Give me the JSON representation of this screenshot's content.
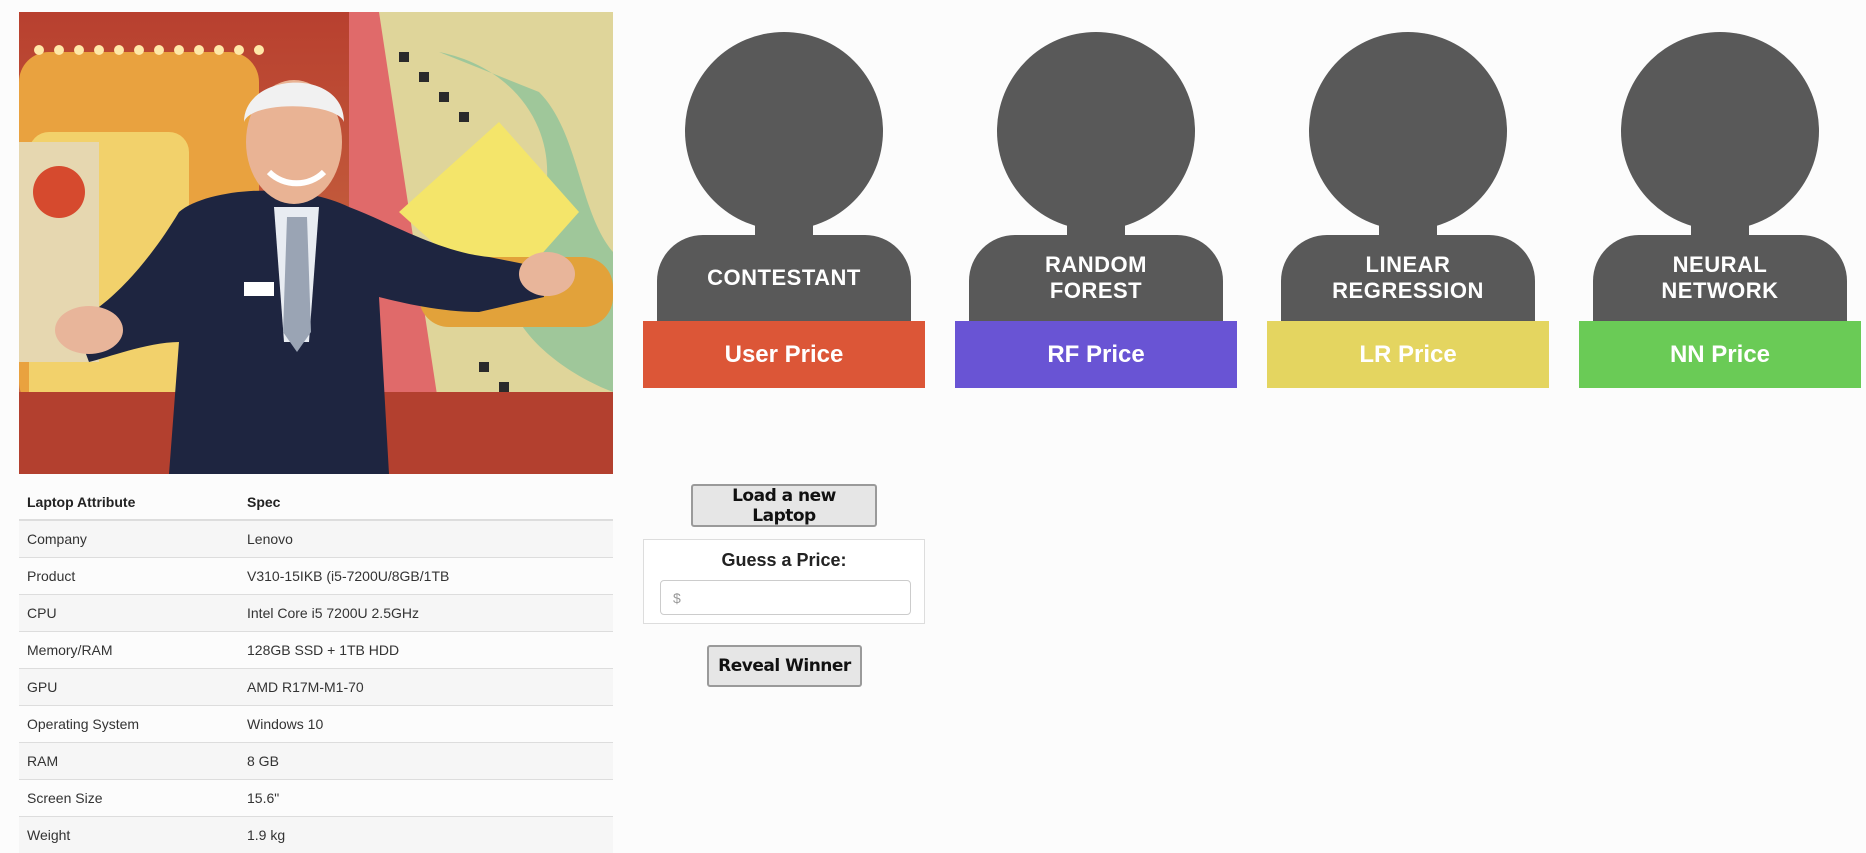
{
  "table": {
    "headers": [
      "Laptop Attribute",
      "Spec"
    ],
    "rows": [
      [
        "Company",
        "Lenovo"
      ],
      [
        "Product",
        "V310-15IKB (i5-7200U/8GB/1TB"
      ],
      [
        "CPU",
        "Intel Core i5 7200U 2.5GHz"
      ],
      [
        "Memory/RAM",
        "128GB SSD + 1TB HDD"
      ],
      [
        "GPU",
        "AMD R17M-M1-70"
      ],
      [
        "Operating System",
        "Windows 10"
      ],
      [
        "RAM",
        "8 GB"
      ],
      [
        "Screen Size",
        "15.6\""
      ],
      [
        "Weight",
        "1.9 kg"
      ]
    ]
  },
  "contestants": [
    {
      "label": "CONTESTANT",
      "price": "User Price",
      "color": "#dc5637"
    },
    {
      "label": "RANDOM\nFOREST",
      "price": "RF Price",
      "color": "#6954d4"
    },
    {
      "label": "LINEAR\nREGRESSION",
      "price": "LR Price",
      "color": "#e4d560"
    },
    {
      "label": "NEURAL\nNETWORK",
      "price": "NN Price",
      "color": "#6acb56"
    }
  ],
  "controls": {
    "load_label": "Load a new Laptop",
    "guess_label": "Guess a Price:",
    "guess_placeholder": "$",
    "reveal_label": "Reveal Winner"
  }
}
